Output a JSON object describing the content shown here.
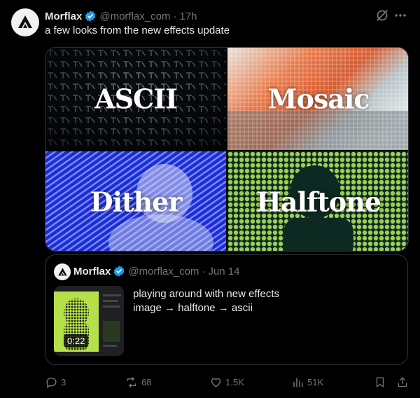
{
  "tweet": {
    "author_name": "Morflax",
    "handle": "@morflax_com",
    "time": "17h",
    "text": "a few looks from the new effects update",
    "media": {
      "tiles": [
        {
          "label": "ASCII"
        },
        {
          "label": "Mosaic"
        },
        {
          "label": "Dither"
        },
        {
          "label": "Halftone"
        }
      ]
    }
  },
  "quoted": {
    "author_name": "Morflax",
    "handle": "@morflax_com",
    "date": "Jun 14",
    "text_line1": "playing around with new effects",
    "text_line2": "image → halftone → ascii",
    "video_duration": "0:22"
  },
  "actions": {
    "replies": "3",
    "reposts": "68",
    "likes": "1.5K",
    "views": "51K"
  },
  "colors": {
    "verified": "#1d9bf0",
    "muted": "#71767b",
    "text": "#e7e9ea",
    "border": "#2f3336"
  },
  "icons": [
    "logo-icon",
    "verified-badge-icon",
    "grok-icon",
    "more-icon",
    "reply-icon",
    "repost-icon",
    "like-icon",
    "views-icon",
    "bookmark-icon",
    "share-icon"
  ]
}
